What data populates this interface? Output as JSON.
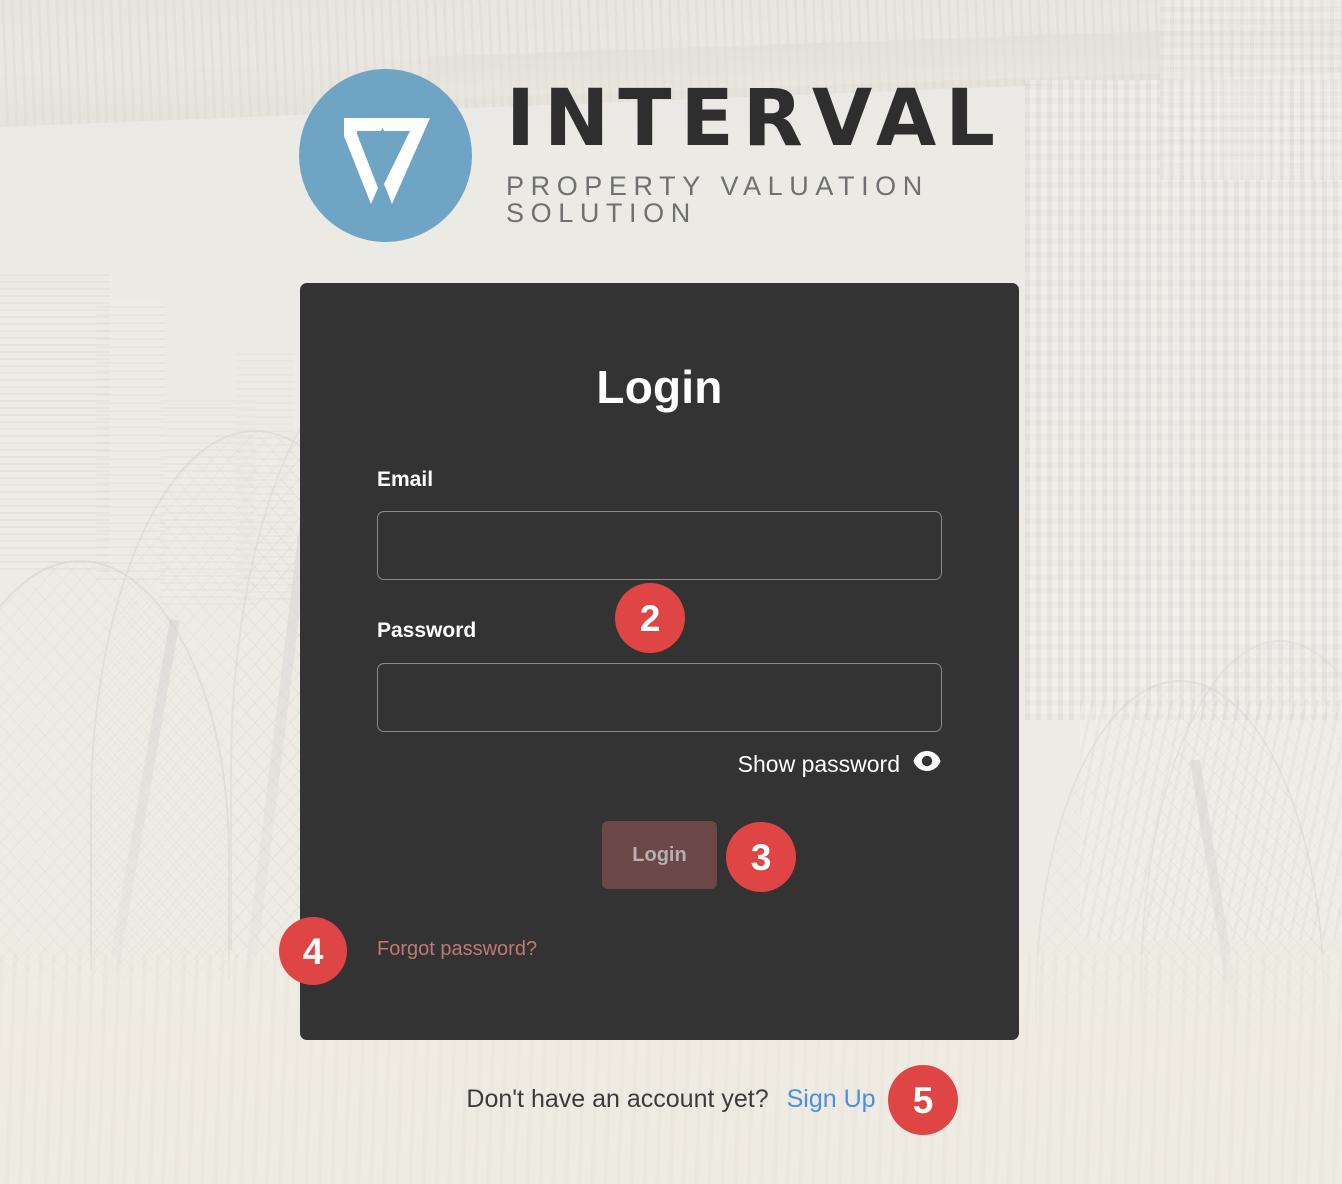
{
  "brand": {
    "logo_icon": "interval-iv-monogram-icon",
    "logo_circle_color": "#6fa4c4",
    "name": "INTERVAL",
    "tagline": "PROPERTY VALUATION SOLUTION"
  },
  "card": {
    "title": "Login",
    "email": {
      "label": "Email",
      "value": "",
      "placeholder": ""
    },
    "password": {
      "label": "Password",
      "value": "",
      "placeholder": ""
    },
    "show_password": {
      "label": "Show password",
      "icon": "eye-icon"
    },
    "submit": {
      "label": "Login",
      "background": "#6b4747",
      "text_color": "#b4b1b1",
      "enabled": false
    },
    "forgot": {
      "label": "Forgot password?",
      "color": "#c07878"
    },
    "background": "#333333"
  },
  "footer": {
    "prompt": "Don't have an account yet?",
    "signup_label": "Sign Up",
    "signup_color": "#4a90e2"
  },
  "annotations": {
    "color": "#e04545",
    "badges": [
      {
        "number": "2",
        "target": "email-input"
      },
      {
        "number": "3",
        "target": "login-button"
      },
      {
        "number": "4",
        "target": "forgot-password-link"
      },
      {
        "number": "5",
        "target": "sign-up-link"
      }
    ]
  }
}
